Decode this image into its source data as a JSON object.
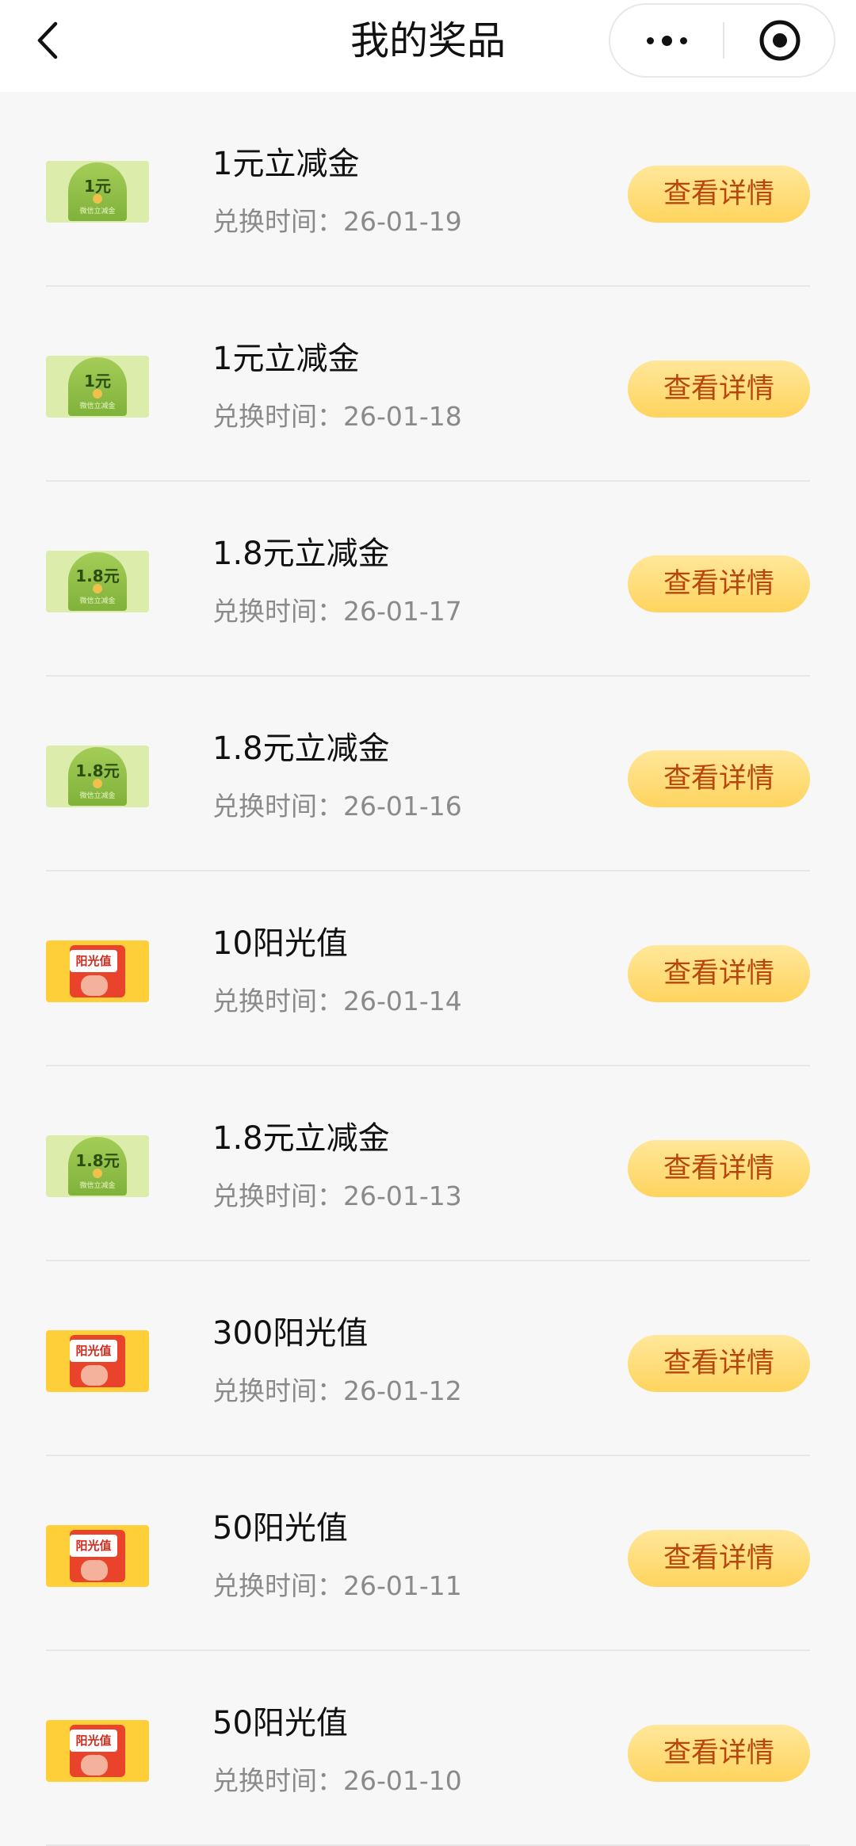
{
  "header": {
    "title": "我的奖品"
  },
  "prizes": [
    {
      "name": "1元立减金",
      "date_label": "兑换时间：",
      "date": "26-01-19",
      "button": "查看详情",
      "thumb": {
        "kind": "green",
        "value": "1元",
        "subtitle": "微信立减金"
      }
    },
    {
      "name": "1元立减金",
      "date_label": "兑换时间：",
      "date": "26-01-18",
      "button": "查看详情",
      "thumb": {
        "kind": "green",
        "value": "1元",
        "subtitle": "微信立减金"
      }
    },
    {
      "name": "1.8元立减金",
      "date_label": "兑换时间：",
      "date": "26-01-17",
      "button": "查看详情",
      "thumb": {
        "kind": "green",
        "value": "1.8元",
        "subtitle": "微信立减金"
      }
    },
    {
      "name": "1.8元立减金",
      "date_label": "兑换时间：",
      "date": "26-01-16",
      "button": "查看详情",
      "thumb": {
        "kind": "green",
        "value": "1.8元",
        "subtitle": "微信立减金"
      }
    },
    {
      "name": "10阳光值",
      "date_label": "兑换时间：",
      "date": "26-01-14",
      "button": "查看详情",
      "thumb": {
        "kind": "orange",
        "label": "阳光值"
      }
    },
    {
      "name": "1.8元立减金",
      "date_label": "兑换时间：",
      "date": "26-01-13",
      "button": "查看详情",
      "thumb": {
        "kind": "green",
        "value": "1.8元",
        "subtitle": "微信立减金"
      }
    },
    {
      "name": "300阳光值",
      "date_label": "兑换时间：",
      "date": "26-01-12",
      "button": "查看详情",
      "thumb": {
        "kind": "orange",
        "label": "阳光值"
      }
    },
    {
      "name": "50阳光值",
      "date_label": "兑换时间：",
      "date": "26-01-11",
      "button": "查看详情",
      "thumb": {
        "kind": "orange",
        "label": "阳光值"
      }
    },
    {
      "name": "50阳光值",
      "date_label": "兑换时间：",
      "date": "26-01-10",
      "button": "查看详情",
      "thumb": {
        "kind": "orange",
        "label": "阳光值"
      }
    }
  ]
}
